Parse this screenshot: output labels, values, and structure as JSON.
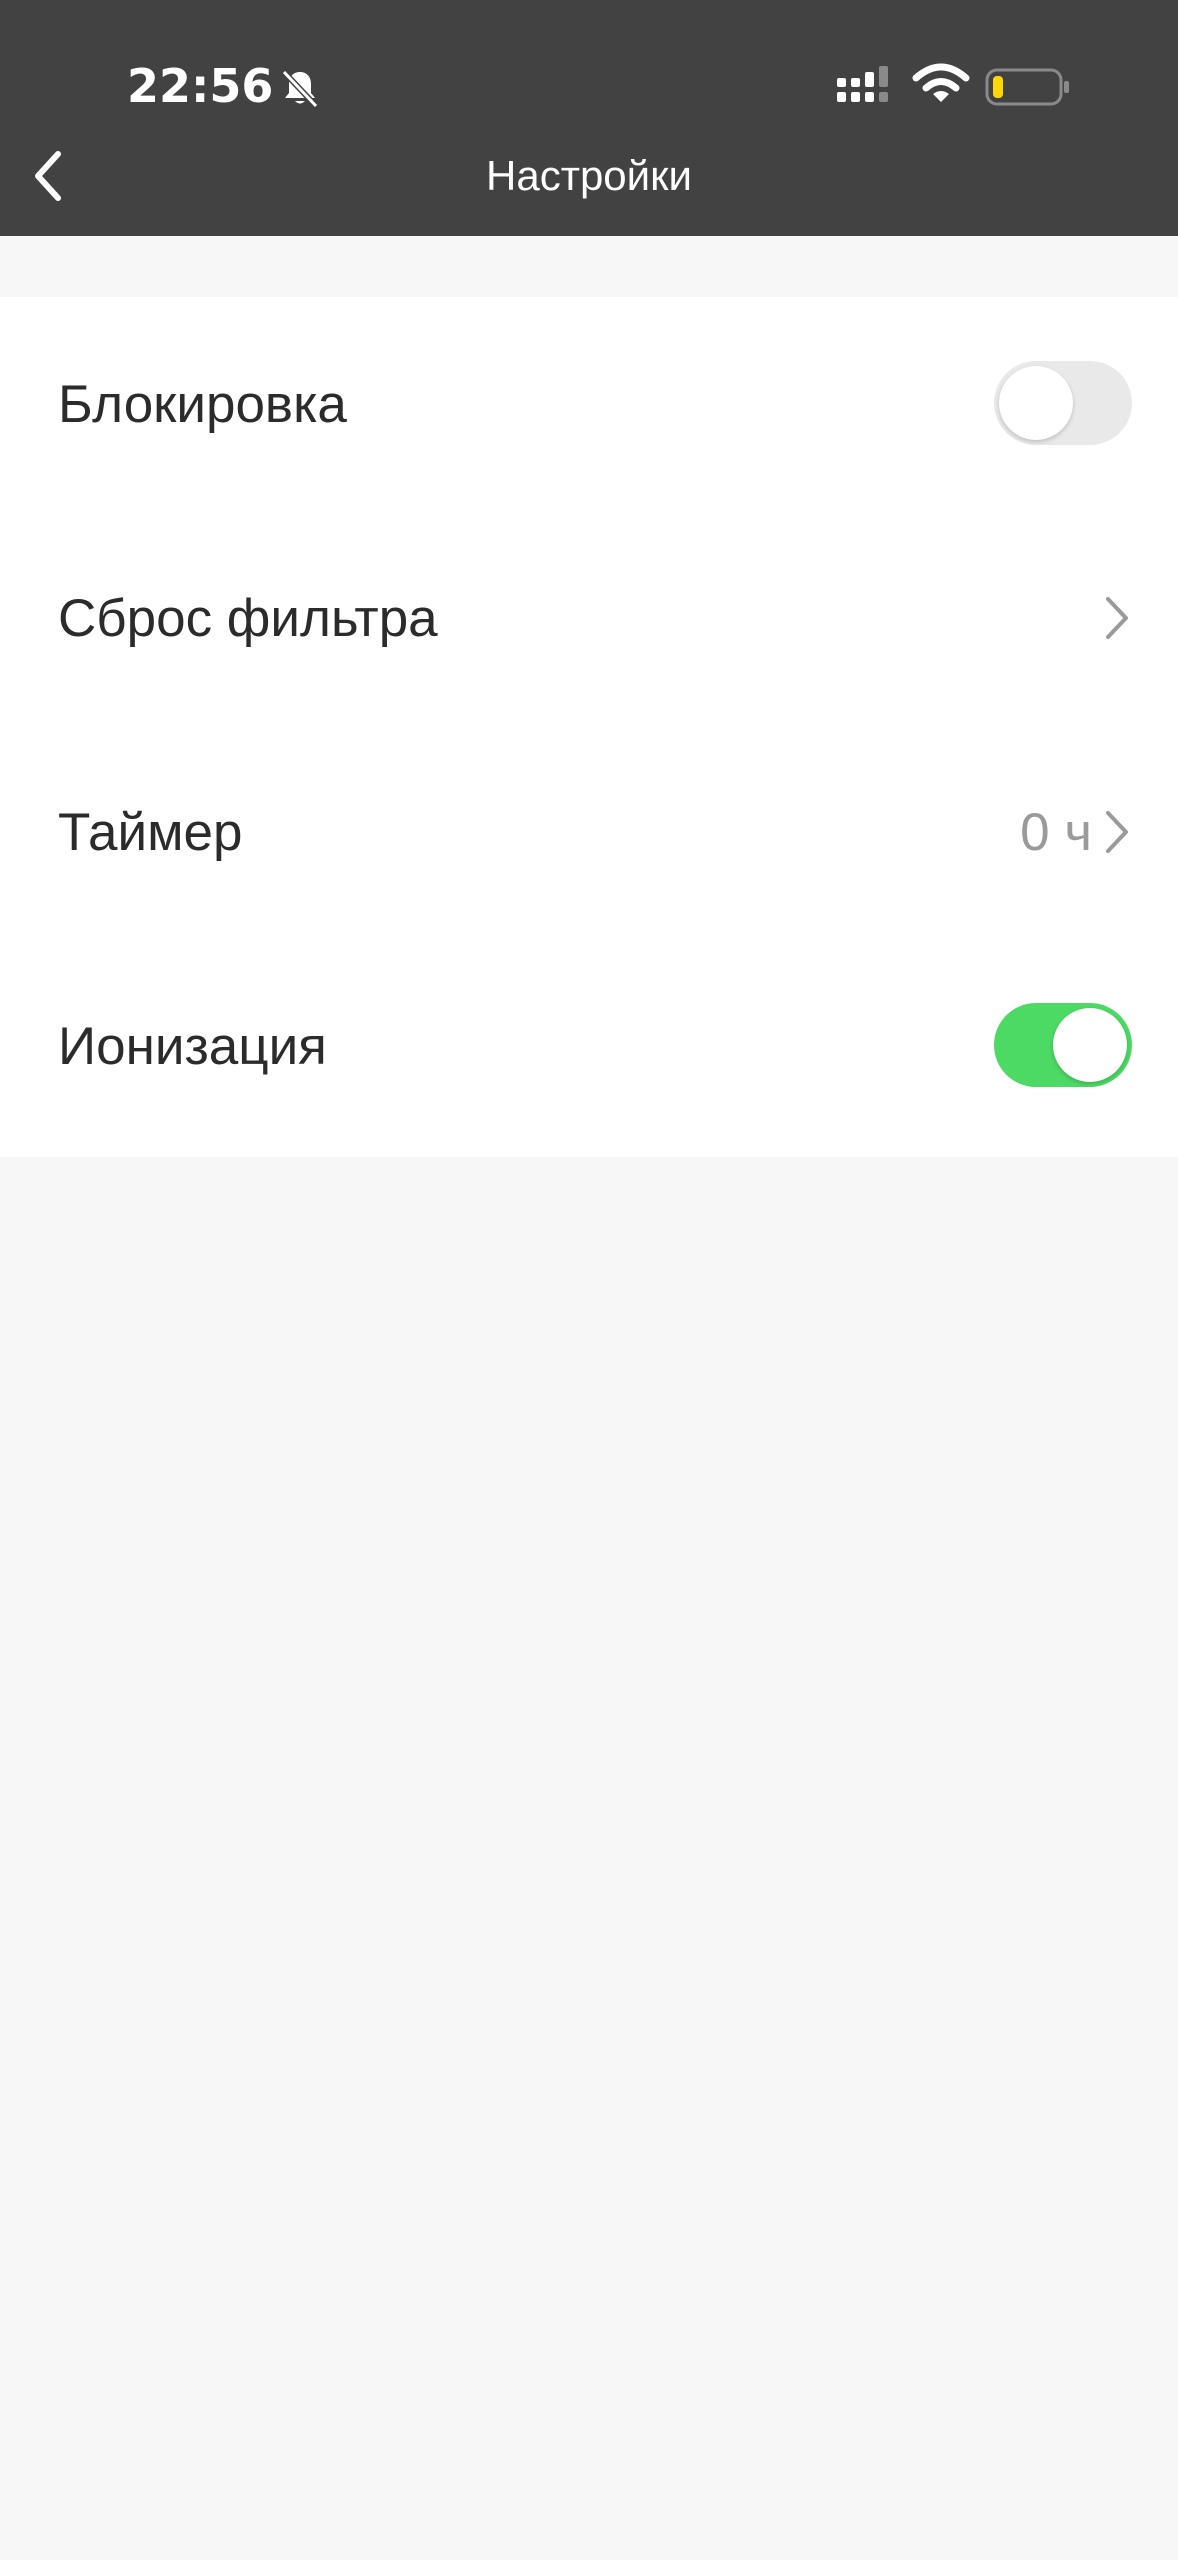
{
  "status_bar": {
    "time": "22:56",
    "icons": [
      "bell-muted-icon",
      "signal-icon",
      "wifi-icon",
      "battery-low-icon"
    ],
    "battery_color": "#ffd60a"
  },
  "header": {
    "title": "Настройки",
    "background": "#424242",
    "back_icon": "chevron-left-icon"
  },
  "settings": {
    "rows": [
      {
        "label": "Блокировка",
        "control": "toggle",
        "checked": false
      },
      {
        "label": "Сброс фильтра",
        "control": "chevron"
      },
      {
        "label": "Таймер",
        "value": "0 ч",
        "control": "chevron"
      },
      {
        "label": "Ионизация",
        "control": "toggle",
        "checked": true
      }
    ]
  },
  "colors": {
    "toggle_on": "#4cd964",
    "toggle_off": "#e9e9ea",
    "background": "#f7f7f7"
  }
}
